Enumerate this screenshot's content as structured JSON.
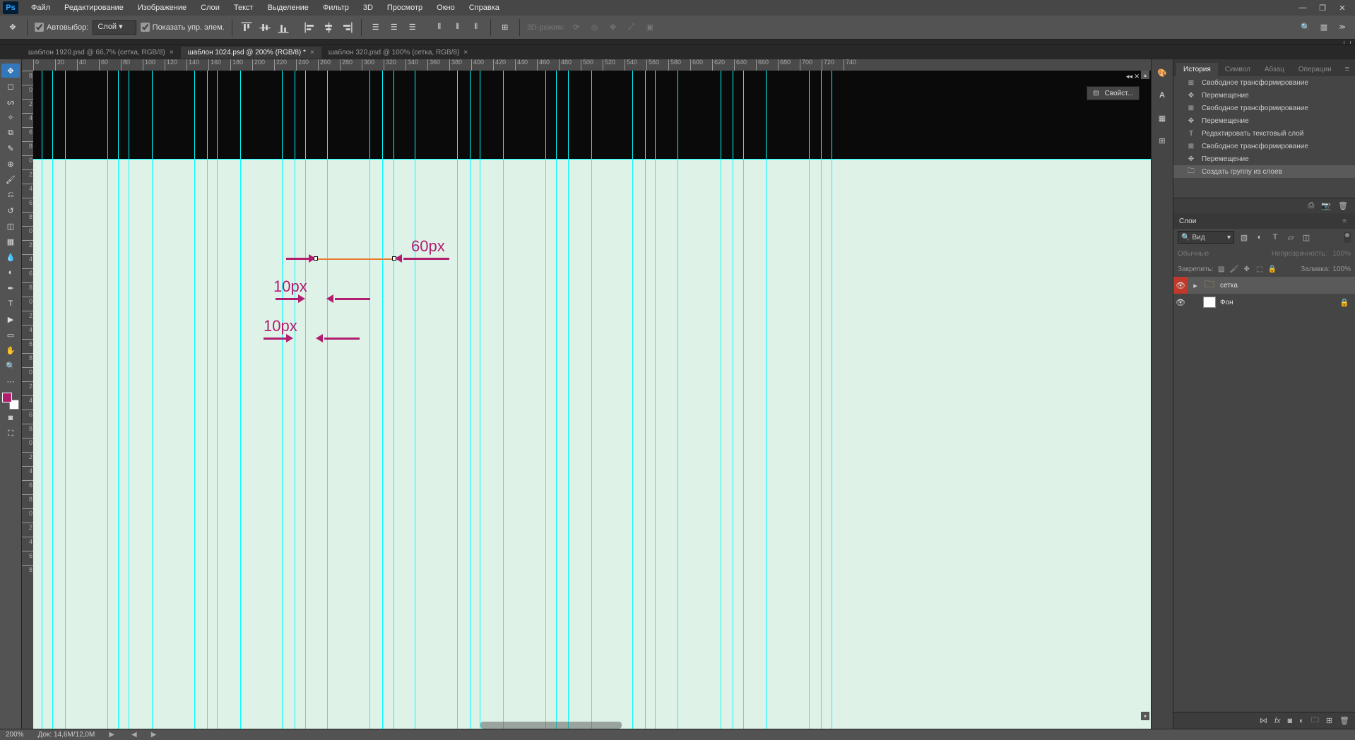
{
  "menu": [
    "Файл",
    "Редактирование",
    "Изображение",
    "Слои",
    "Текст",
    "Выделение",
    "Фильтр",
    "3D",
    "Просмотр",
    "Окно",
    "Справка"
  ],
  "options": {
    "auto_select": "Автовыбор:",
    "layer_mode": "Слой",
    "show_transform": "Показать упр. элем.",
    "mode3d": "3D-режим:"
  },
  "tabs": [
    {
      "label": "шаблон 1920.psd @ 66,7% (сетка, RGB/8)",
      "active": false
    },
    {
      "label": "шаблон 1024.psd @ 200% (RGB/8) *",
      "active": true
    },
    {
      "label": "шаблон 320.psd @ 100% (сетка, RGB/8)",
      "active": false
    }
  ],
  "ruler_h": [
    0,
    20,
    40,
    60,
    80,
    100,
    120,
    140,
    160,
    180,
    200,
    220,
    240,
    260,
    280,
    300,
    320,
    340,
    360,
    380,
    400,
    420,
    440,
    460,
    480,
    500,
    520,
    540,
    560,
    580,
    600,
    620,
    640,
    660,
    680,
    700,
    720,
    740
  ],
  "ruler_v": [
    8,
    0,
    2,
    4,
    6,
    8,
    0,
    2,
    4,
    6,
    8,
    0,
    2,
    4,
    6,
    8,
    0,
    2,
    4,
    6,
    8,
    0,
    2,
    4,
    6,
    8,
    0,
    2,
    4,
    6,
    8,
    0,
    2,
    4,
    6,
    8
  ],
  "annot": {
    "a1": "60px",
    "a2": "10px",
    "a3": "10px"
  },
  "float_panel": "Свойст...",
  "panel_tabs_top": [
    "История",
    "Символ",
    "Абзац",
    "Операции"
  ],
  "history": [
    {
      "icon": "transform",
      "label": "Свободное трансформирование"
    },
    {
      "icon": "move",
      "label": "Перемещение"
    },
    {
      "icon": "transform",
      "label": "Свободное трансформирование"
    },
    {
      "icon": "move",
      "label": "Перемещение"
    },
    {
      "icon": "text",
      "label": "Редактировать текстовый слой"
    },
    {
      "icon": "transform",
      "label": "Свободное трансформирование"
    },
    {
      "icon": "move",
      "label": "Перемещение"
    },
    {
      "icon": "group",
      "label": "Создать группу из слоев",
      "sel": true
    }
  ],
  "layers_tab": "Слои",
  "layers_filter_label": "Вид",
  "blend": {
    "mode": "Обычные",
    "opacity_l": "Непрозрачность:",
    "opacity_v": "100%",
    "lock_l": "Закрепить:",
    "fill_l": "Заливка:",
    "fill_v": "100%"
  },
  "layers": [
    {
      "kind": "group",
      "name": "сетка",
      "eye": true,
      "eye_red": true,
      "sel": true
    },
    {
      "kind": "bg",
      "name": "Фон",
      "eye": true,
      "locked": true
    }
  ],
  "status": {
    "zoom": "200%",
    "doc": "Док: 14,6M/12,0M"
  }
}
